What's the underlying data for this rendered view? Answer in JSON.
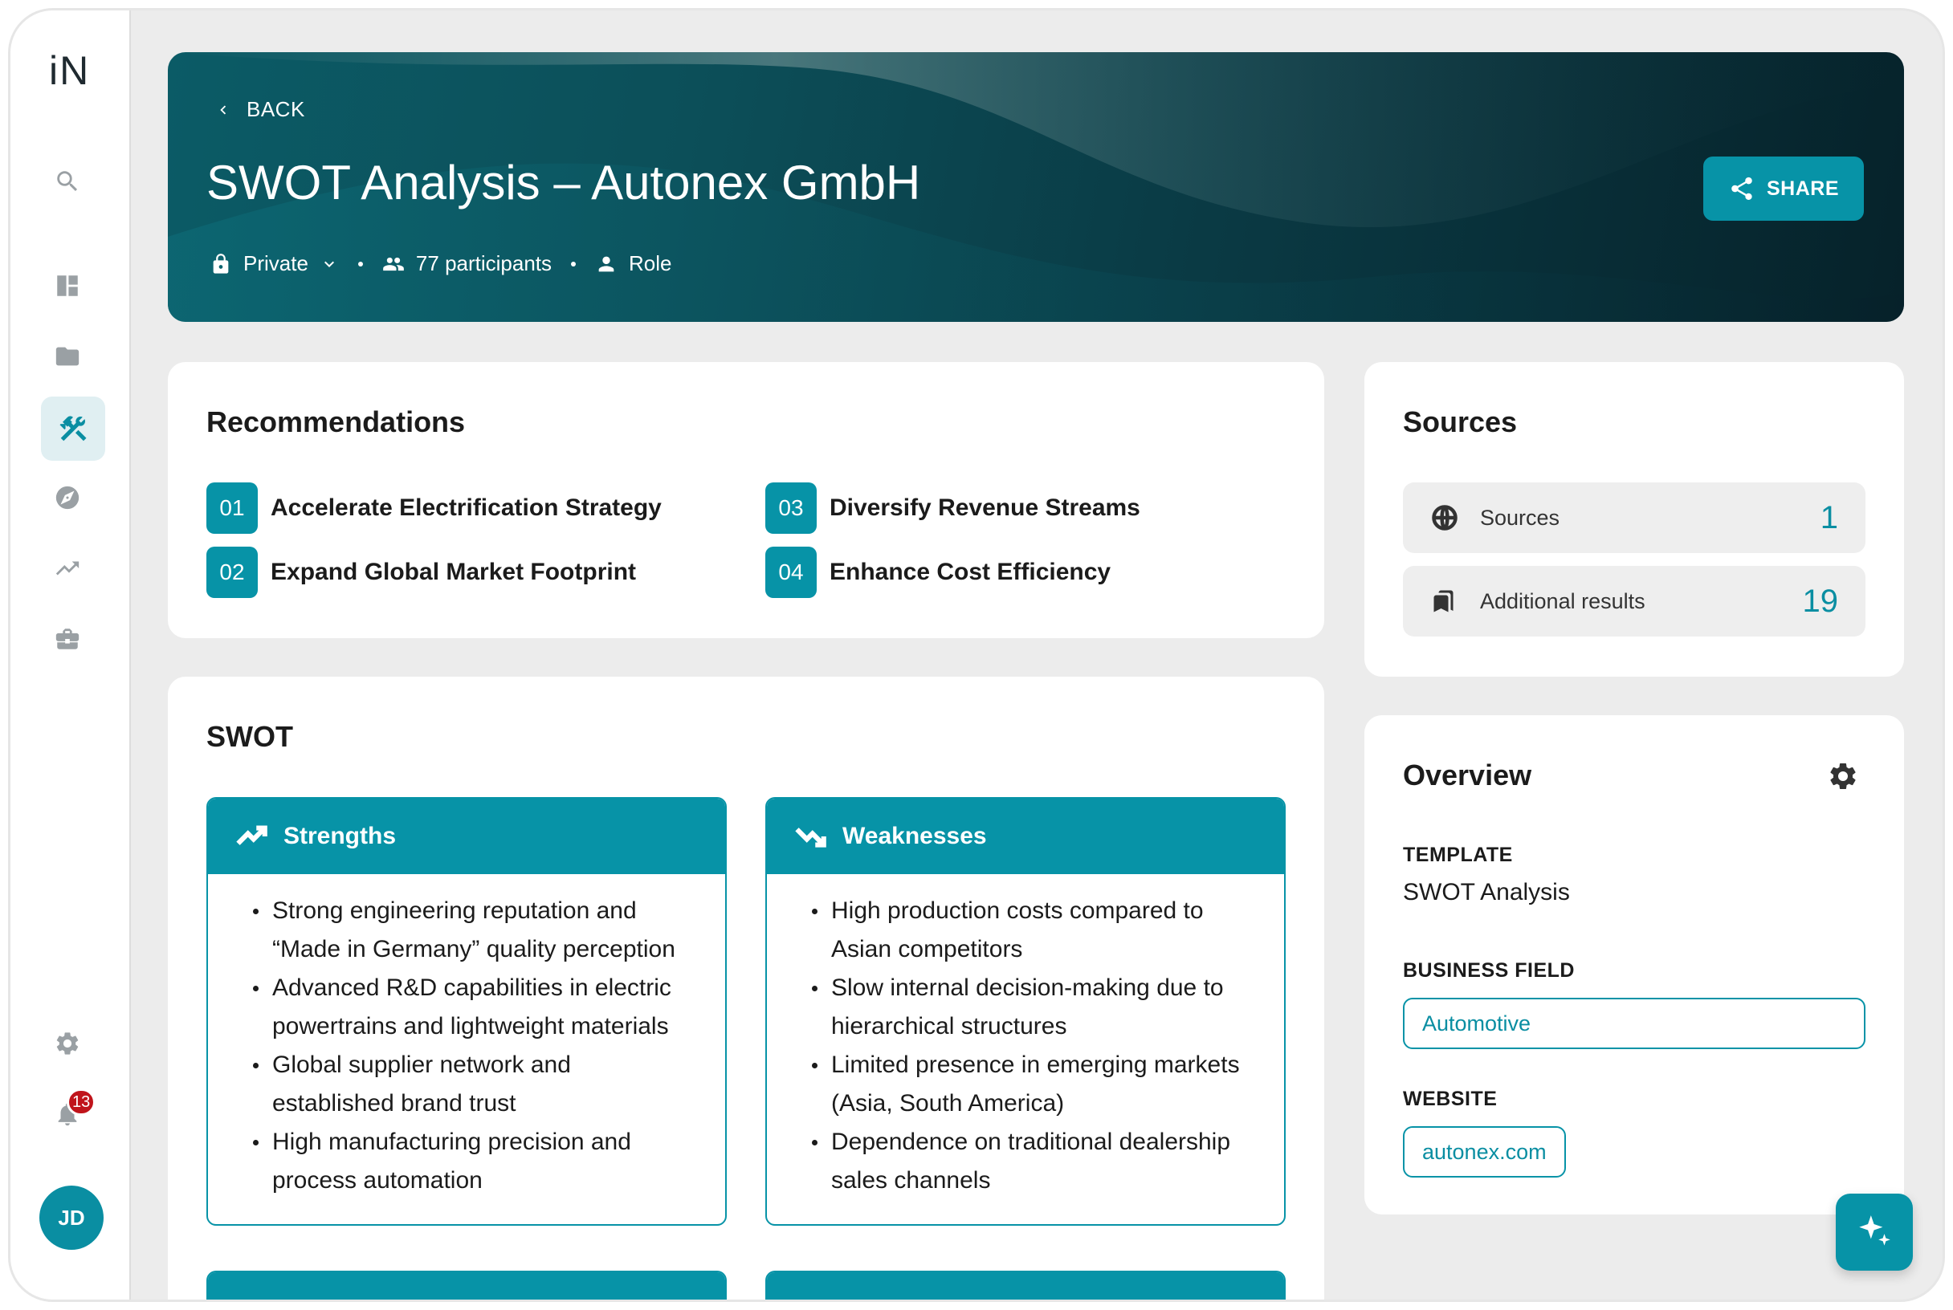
{
  "sidebar": {
    "logo": "iN",
    "nav": [
      "search-icon",
      "dashboard-icon",
      "folder-icon",
      "tools-icon",
      "compass-icon",
      "trending-icon",
      "briefcase-icon"
    ],
    "notifications_count": "13",
    "avatar_initials": "JD"
  },
  "header": {
    "back_label": "BACK",
    "title": "SWOT Analysis – Autonex GmbH",
    "visibility": "Private",
    "participants": "77 participants",
    "role": "Role",
    "share_label": "SHARE"
  },
  "recommendations": {
    "title": "Recommendations",
    "items": [
      {
        "num": "01",
        "label": "Accelerate Electrification Strategy"
      },
      {
        "num": "02",
        "label": "Expand Global Market Footprint"
      },
      {
        "num": "03",
        "label": "Diversify Revenue Streams"
      },
      {
        "num": "04",
        "label": "Enhance Cost Efficiency"
      }
    ]
  },
  "swot": {
    "title": "SWOT",
    "strengths": {
      "title": "Strengths",
      "items": [
        "Strong engineering reputation and “Made in Germany” quality perception",
        "Advanced R&D capabilities in electric powertrains and lightweight materials",
        "Global supplier network and established brand trust",
        "High manufacturing precision and process automation"
      ]
    },
    "weaknesses": {
      "title": "Weaknesses",
      "items": [
        "High production costs compared to Asian competitors",
        "Slow internal decision-making due to hierarchical structures",
        "Limited presence in emerging markets (Asia, South America)",
        "Dependence on traditional dealership sales channels"
      ]
    }
  },
  "sources": {
    "title": "Sources",
    "rows": [
      {
        "label": "Sources",
        "value": "1"
      },
      {
        "label": "Additional results",
        "value": "19"
      }
    ]
  },
  "overview": {
    "title": "Overview",
    "template_label": "TEMPLATE",
    "template_value": "SWOT Analysis",
    "business_field_label": "BUSINESS FIELD",
    "business_field_value": "Automotive",
    "website_label": "WEBSITE",
    "website_value": "autonex.com"
  },
  "colors": {
    "accent": "#0793a7",
    "badge": "#c0141b",
    "background": "#ececec"
  }
}
